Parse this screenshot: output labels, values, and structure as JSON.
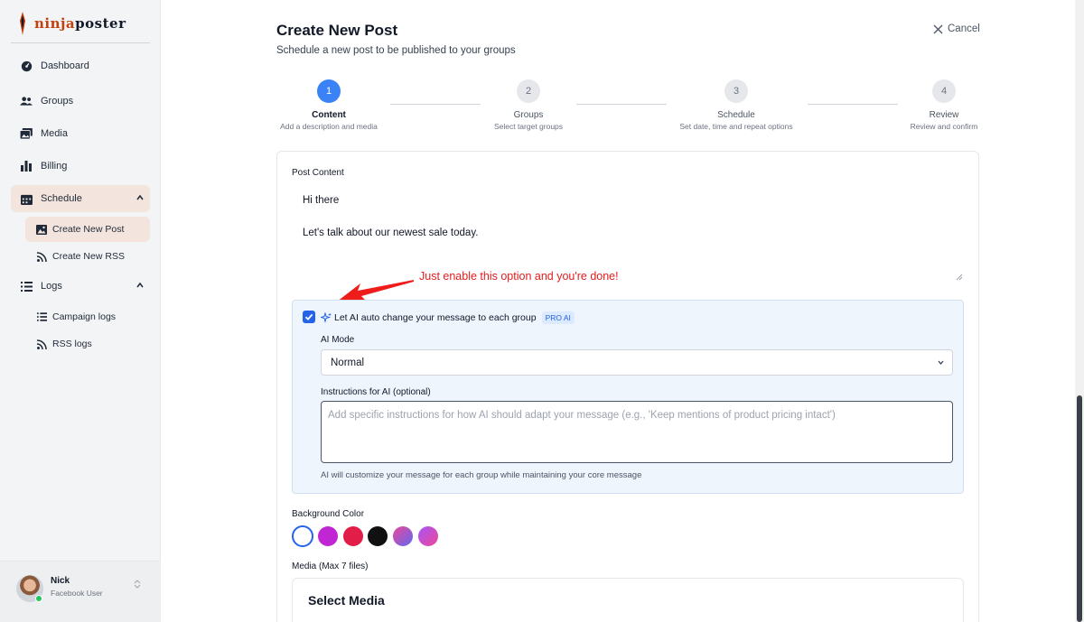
{
  "brand": {
    "logo_part1": "ninja",
    "logo_part2": "poster"
  },
  "sidebar": {
    "items": [
      {
        "label": "Dashboard",
        "icon": "dashboard-icon"
      },
      {
        "label": "Groups",
        "icon": "users-icon"
      },
      {
        "label": "Media",
        "icon": "media-icon"
      },
      {
        "label": "Billing",
        "icon": "bar-chart-icon"
      },
      {
        "label": "Schedule",
        "icon": "calendar-icon",
        "expanded": true
      },
      {
        "label": "Logs",
        "icon": "list-icon",
        "expanded": true
      }
    ],
    "schedule_sub": [
      {
        "label": "Create New Post",
        "icon": "image-icon",
        "active": true
      },
      {
        "label": "Create New RSS",
        "icon": "rss-icon"
      }
    ],
    "logs_sub": [
      {
        "label": "Campaign logs",
        "icon": "list-icon"
      },
      {
        "label": "RSS logs",
        "icon": "rss-icon"
      }
    ],
    "user": {
      "name": "Nick",
      "role": "Facebook User"
    }
  },
  "header": {
    "title": "Create New Post",
    "subtitle": "Schedule a new post to be published to your groups",
    "cancel_label": "Cancel"
  },
  "steps": [
    {
      "num": "1",
      "label": "Content",
      "desc": "Add a description and media",
      "active": true
    },
    {
      "num": "2",
      "label": "Groups",
      "desc": "Select target groups"
    },
    {
      "num": "3",
      "label": "Schedule",
      "desc": "Set date, time and repeat options"
    },
    {
      "num": "4",
      "label": "Review",
      "desc": "Review and confirm"
    }
  ],
  "post": {
    "label": "Post Content",
    "line1": "Hi there",
    "line2": "Let's talk about our newest sale today."
  },
  "annotation": "Just enable this option and you're done!",
  "ai": {
    "checked": true,
    "toggle_label": "Let AI auto change your message to each group",
    "badge": "PRO AI",
    "mode_label": "AI Mode",
    "mode_value": "Normal",
    "instructions_label": "Instructions for AI (optional)",
    "instructions_placeholder": "Add specific instructions for how AI should adapt your message (e.g., 'Keep mentions of product pricing intact')",
    "hint": "AI will customize your message for each group while maintaining your core message"
  },
  "background": {
    "label": "Background Color",
    "colors": [
      "#ffffff",
      "#c026d3",
      "#e11d48",
      "#111111",
      "linear-gradient(135deg,#ec4899,#6366f1)",
      "linear-gradient(135deg,#a855f7,#ec4899)"
    ]
  },
  "media": {
    "label": "Media (Max 7 files)",
    "select_title": "Select Media"
  }
}
